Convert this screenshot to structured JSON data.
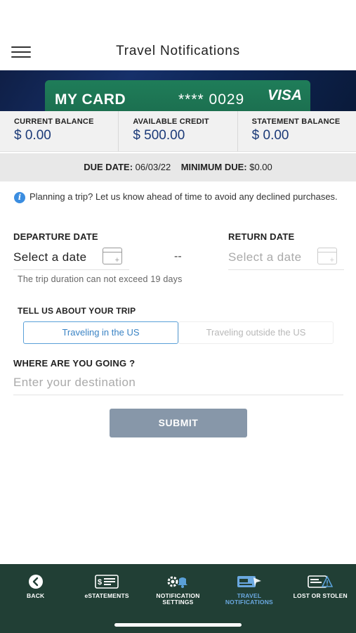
{
  "header": {
    "title": "Travel Notifications"
  },
  "card": {
    "name": "MY CARD",
    "number": "**** 0029",
    "network": "VISA"
  },
  "balances": [
    {
      "label": "CURRENT BALANCE",
      "value": "$ 0.00"
    },
    {
      "label": "AVAILABLE CREDIT",
      "value": "$ 500.00"
    },
    {
      "label": "STATEMENT BALANCE",
      "value": "$ 0.00"
    }
  ],
  "due": {
    "due_label": "DUE DATE:",
    "due_value": "06/03/22",
    "min_label": "MINIMUM DUE:",
    "min_value": "$0.00"
  },
  "info": {
    "text": "Planning a trip? Let us know ahead of time to avoid any declined purchases."
  },
  "form": {
    "departure_label": "DEPARTURE DATE",
    "departure_value": "Select a date",
    "separator": "--",
    "return_label": "RETURN DATE",
    "return_value": "Select a date",
    "hint": "The trip duration can not exceed 19 days",
    "trip_label": "TELL US ABOUT YOUR TRIP",
    "trip_options": [
      "Traveling in the US",
      "Traveling outside the US"
    ],
    "trip_selected": "Traveling in the US",
    "destination_label": "WHERE ARE YOU GOING ?",
    "destination_placeholder": "Enter your destination",
    "submit_label": "SUBMIT"
  },
  "nav": {
    "items": [
      {
        "label": "BACK",
        "icon": "back-icon"
      },
      {
        "label": "eSTATEMENTS",
        "icon": "statement-icon"
      },
      {
        "label": "NOTIFICATION SETTINGS",
        "icon": "notification-settings-icon"
      },
      {
        "label": "TRAVEL NOTIFICATIONS",
        "icon": "travel-icon",
        "active": true
      },
      {
        "label": "LOST OR STOLEN",
        "icon": "lost-card-icon"
      }
    ]
  },
  "colors": {
    "accent": "#3a83c4",
    "nav_bg": "#213f35",
    "card_green": "#1b6b4d",
    "submit_bg": "#8797a9",
    "balance_value": "#1b3a78"
  }
}
